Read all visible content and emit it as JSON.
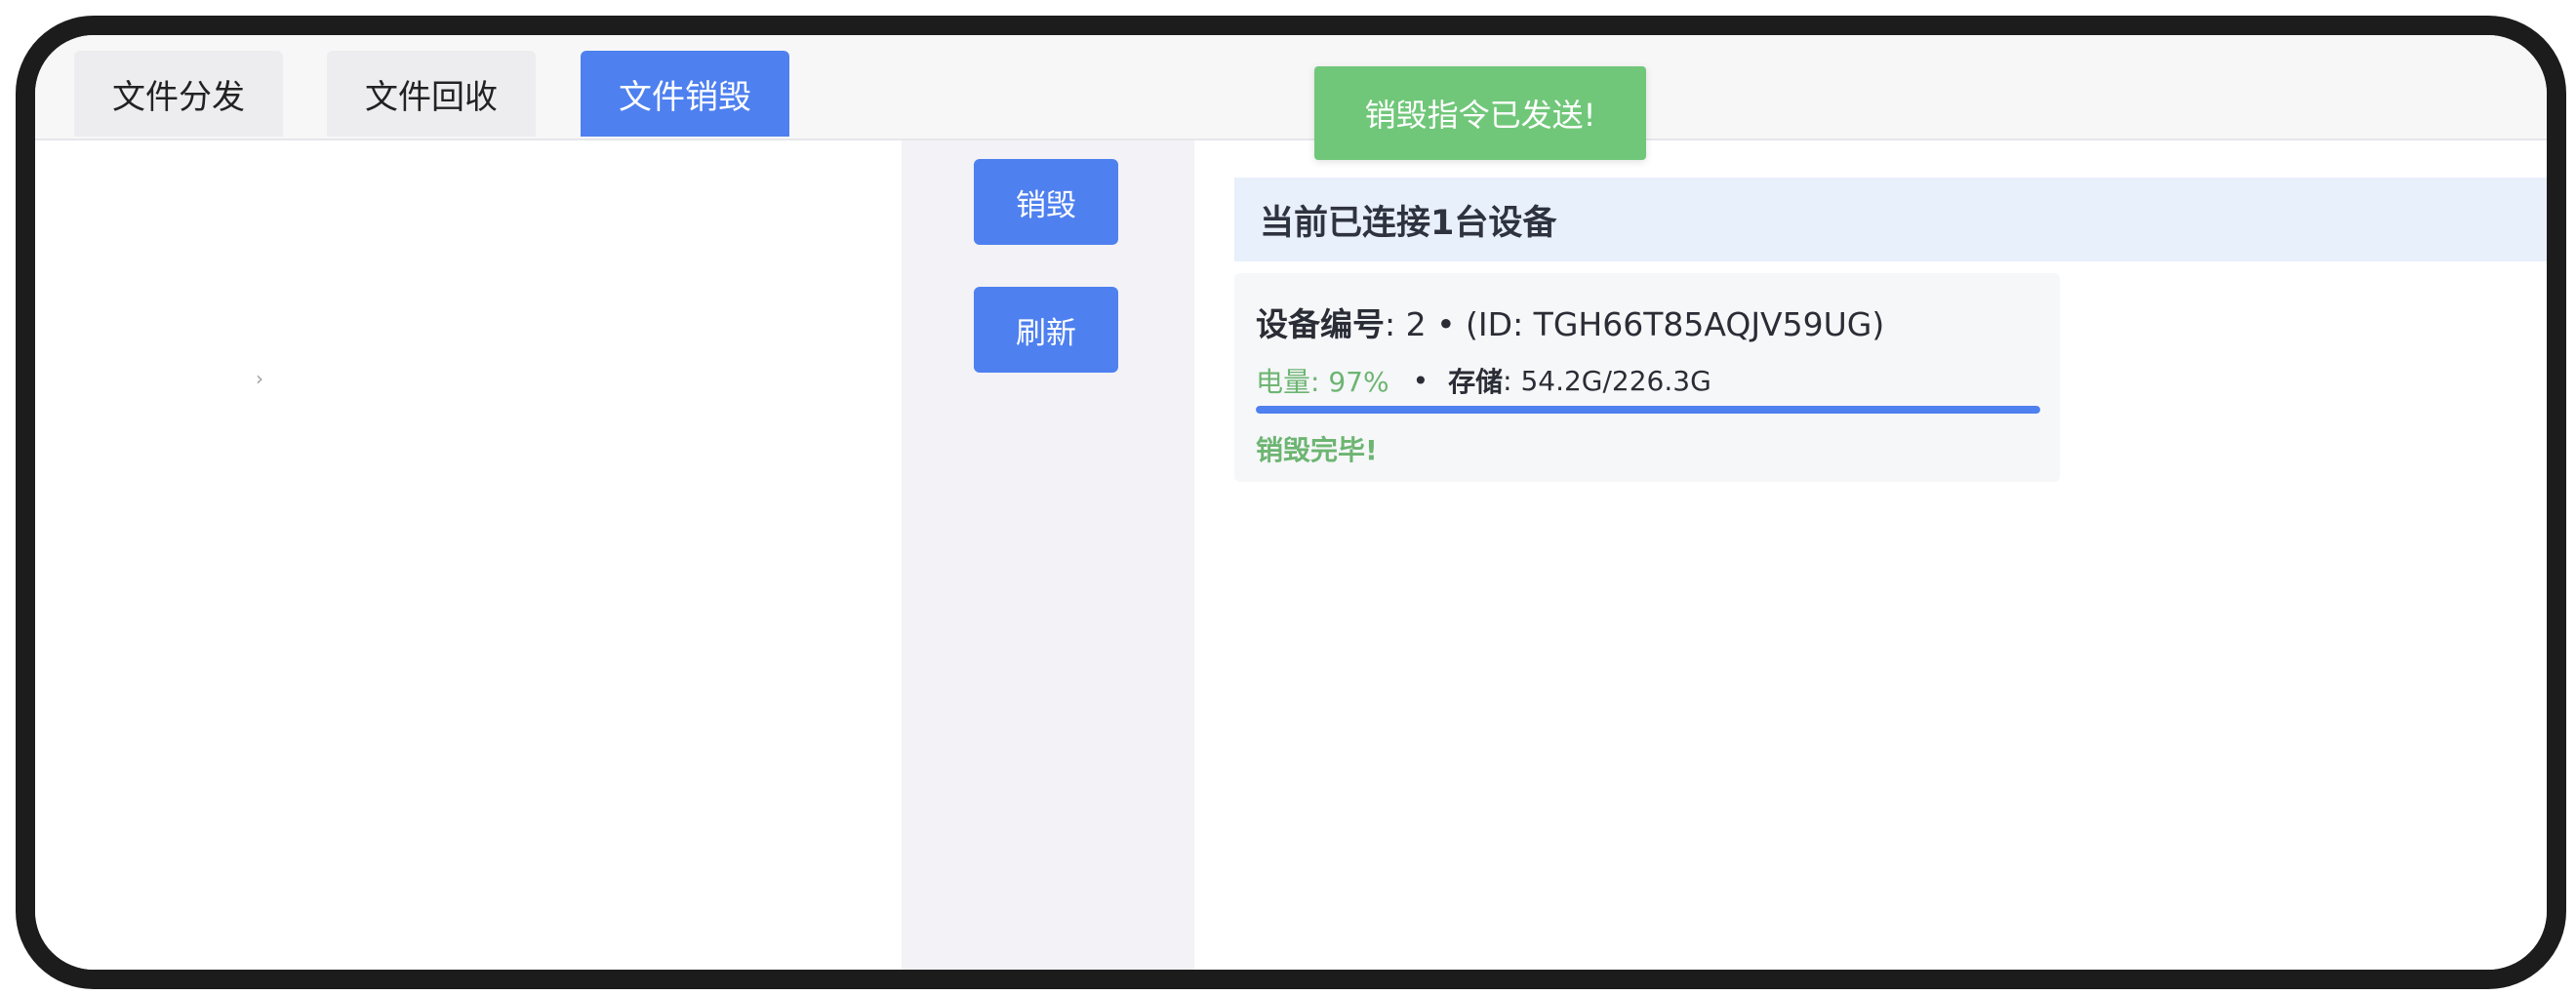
{
  "tabs": [
    {
      "label": "文件分发",
      "active": false
    },
    {
      "label": "文件回收",
      "active": false
    },
    {
      "label": "文件销毁",
      "active": true
    }
  ],
  "toast": {
    "text": "销毁指令已发送!"
  },
  "tree": {
    "expand_glyph": "›"
  },
  "actions": {
    "destroy_label": "销毁",
    "refresh_label": "刷新"
  },
  "connection": {
    "summary": "当前已连接1台设备"
  },
  "device": {
    "title_label": "设备编号",
    "title_value": ": 2 • (ID: TGH66T85AQJV59UG)",
    "battery": "电量: 97%",
    "separator": "•",
    "storage_label": "存储",
    "storage_value": ": 54.2G/226.3G",
    "progress": 1.0,
    "status": "销毁完毕!"
  },
  "colors": {
    "accent": "#4e80ef",
    "success": "#6db572",
    "toast_bg": "#70c779"
  }
}
